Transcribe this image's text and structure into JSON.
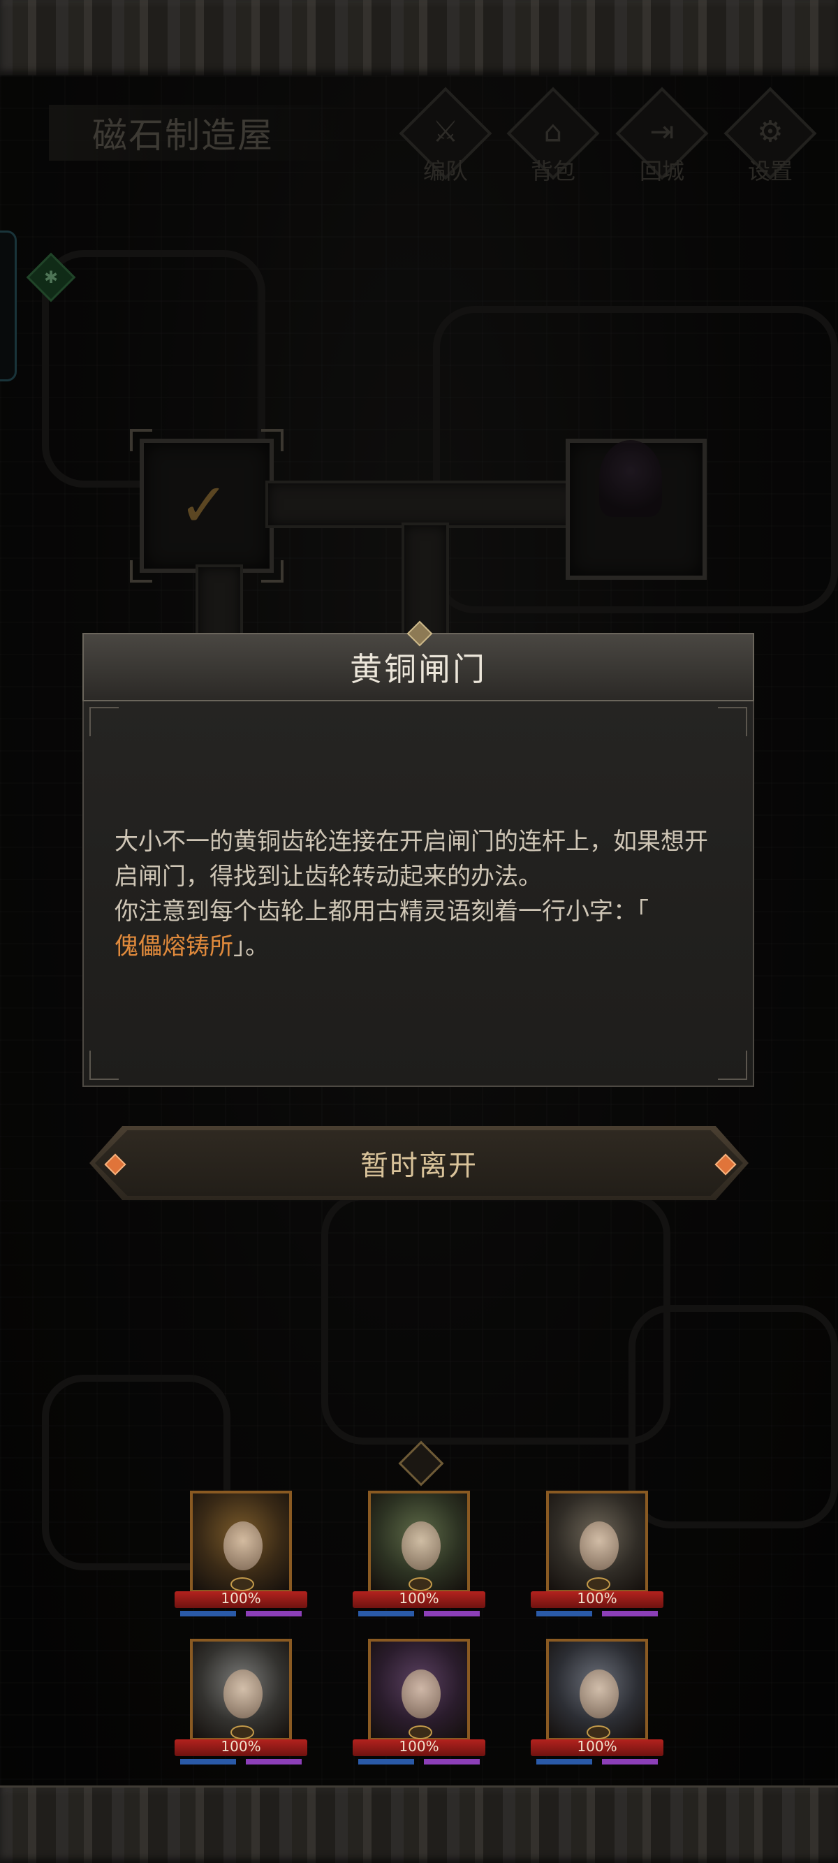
{
  "location": {
    "title": "磁石制造屋"
  },
  "menu": [
    {
      "label": "编队",
      "icon": "team-helmet-icon",
      "glyph": "⚔"
    },
    {
      "label": "背包",
      "icon": "backpack-icon",
      "glyph": "⌂"
    },
    {
      "label": "回城",
      "icon": "return-door-icon",
      "glyph": "⇥"
    },
    {
      "label": "设置",
      "icon": "settings-gear-icon",
      "glyph": "⚙"
    }
  ],
  "dialog": {
    "title": "黄铜闸门",
    "line1": "大小不一的黄铜齿轮连接在开启闸门的连杆上，如果想开启闸门，得找到让齿轮转动起来的办法。",
    "line2": "你注意到每个齿轮上都用古精灵语刻着一行小字：「",
    "highlight": "傀儡熔铸所",
    "line3": "」。"
  },
  "leave_button": {
    "label": "暂时离开"
  },
  "party": [
    {
      "hp": "100%",
      "portrait": "blonde-heroine",
      "c1": "#7a5a2a",
      "c2": "#3a2a16"
    },
    {
      "hp": "100%",
      "portrait": "green-hair-heroine",
      "c1": "#5e6a48",
      "c2": "#2c3222"
    },
    {
      "hp": "100%",
      "portrait": "silver-hair-heroine",
      "c1": "#6e6658",
      "c2": "#302c26"
    },
    {
      "hp": "100%",
      "portrait": "white-hood-heroine",
      "c1": "#7a7a78",
      "c2": "#33322f"
    },
    {
      "hp": "100%",
      "portrait": "dark-elf-heroine",
      "c1": "#5a4060",
      "c2": "#2a1c2c"
    },
    {
      "hp": "100%",
      "portrait": "white-hair-blue-eye-heroine",
      "c1": "#6a6e78",
      "c2": "#2c2e34"
    }
  ]
}
